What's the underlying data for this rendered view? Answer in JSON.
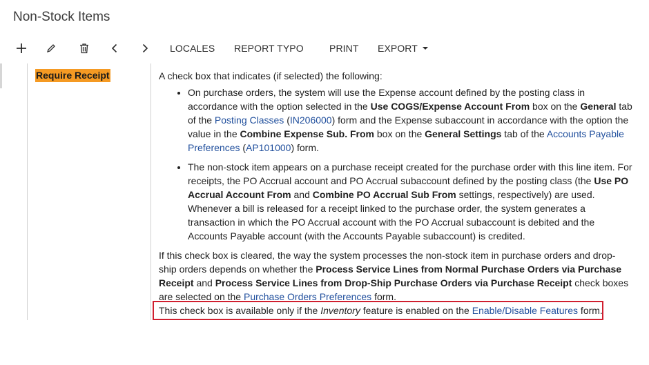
{
  "page": {
    "title": "Non-Stock Items"
  },
  "toolbar": {
    "add_icon": "plus-icon",
    "edit_icon": "pencil-icon",
    "delete_icon": "trash-icon",
    "prev_icon": "chevron-left-icon",
    "next_icon": "chevron-right-icon",
    "locales": "LOCALES",
    "report_typo": "REPORT TYPO",
    "print": "PRINT",
    "export": "EXPORT"
  },
  "row": {
    "param_name": "Require Receipt",
    "intro": "A check box that indicates (if selected) the following:",
    "bullet1": {
      "t1": "On purchase orders, the system will use the Expense account defined by the posting class in accordance with the option selected in the ",
      "b1": "Use COGS/Expense Account From",
      "t2": " box on the ",
      "b2": "General",
      "t3": " tab of the ",
      "l1": "Posting Classes",
      "t4": " (",
      "l2": "IN206000",
      "t5": ") form and the Expense subaccount in accordance with the option the value in the ",
      "b3": "Combine Expense Sub. From",
      "t6": " box on the ",
      "b4": "General Settings",
      "t7": " tab of the ",
      "l3": "Accounts Payable Preferences",
      "t8": " (",
      "l4": "AP101000",
      "t9": ") form."
    },
    "bullet2": {
      "t1": "The non-stock item appears on a purchase receipt created for the purchase order with this line item. For receipts, the PO Accrual account and PO Accrual subaccount defined by the posting class (the ",
      "b1": "Use PO Accrual Account From",
      "t2": " and ",
      "b2": "Combine PO Accrual Sub From",
      "t3": " settings, respectively) are used. Whenever a bill is released for a receipt linked to the purchase order, the system generates a transaction in which the PO Accrual account with the PO Accrual subaccount is debited and the Accounts Payable account (with the Accounts Payable subaccount) is credited."
    },
    "cleared": {
      "t1": "If this check box is cleared, the way the system processes the non-stock item in purchase orders and drop-ship orders depends on whether the ",
      "b1": "Process Service Lines from Normal Purchase Orders via Purchase Receipt",
      "t2": " and ",
      "b2": "Process Service Lines from Drop-Ship Purchase Orders via Purchase Receipt",
      "t3": " check boxes are selected on the ",
      "l1": "Purchase Orders Preferences",
      "t4": " form."
    },
    "note": {
      "t1": "This check box is available only if the ",
      "i1": "Inventory",
      "t2": " feature is enabled on the ",
      "l1": "Enable/Disable Features",
      "t3": " form."
    }
  },
  "colors": {
    "highlight": "#f59a23",
    "link": "#1f4e9c",
    "note_border": "#d01f2f"
  }
}
